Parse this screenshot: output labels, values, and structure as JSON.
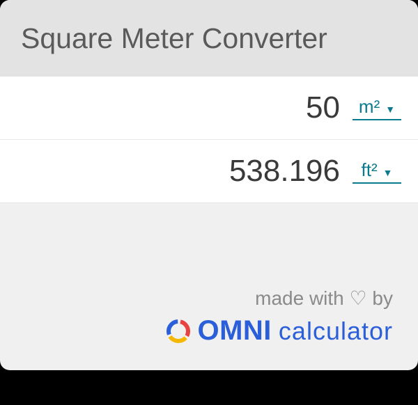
{
  "header": {
    "title": "Square Meter Converter"
  },
  "rows": [
    {
      "value": "50",
      "unit": "m²"
    },
    {
      "value": "538.196",
      "unit": "ft²"
    }
  ],
  "footer": {
    "made_with": "made with ♡ by",
    "brand": "OMNI",
    "product": "calculator"
  }
}
